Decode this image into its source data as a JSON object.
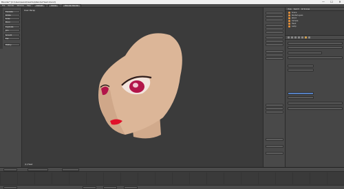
{
  "window": {
    "title": "Blender* [C:\\Users\\sara\\Desktop\\RenderHead.blend]",
    "controls": [
      "—",
      "☐",
      "✕"
    ]
  },
  "menubar": {
    "items": [
      "File",
      "Render",
      "Window",
      "Help"
    ],
    "layout": "Default",
    "scene": "Scene",
    "engine": "Blender Render"
  },
  "viewport": {
    "view_label": "User Persp",
    "object_label": "(1) Head"
  },
  "toolshelf": {
    "buttons": [
      "Translate",
      "Rotate",
      "Scale",
      "Mirror",
      "Duplicate",
      "Join",
      "Smooth",
      "Flat",
      "History"
    ]
  },
  "outliner": {
    "header": [
      "View",
      "Search",
      "All Scenes"
    ],
    "rows": [
      "Scene",
      "RenderLayers",
      "World",
      "Camera",
      "Head",
      "Lamp"
    ]
  },
  "colors": {
    "skin": "#d8b394",
    "iris": "#b2154a",
    "lips": "#e0102a",
    "viewport_bg": "#3b3b3b",
    "accent": "#5680c2"
  },
  "icons": [
    "render-icon",
    "scene-icon",
    "world-icon",
    "object-icon",
    "modifier-icon",
    "material-icon",
    "texture-icon"
  ]
}
